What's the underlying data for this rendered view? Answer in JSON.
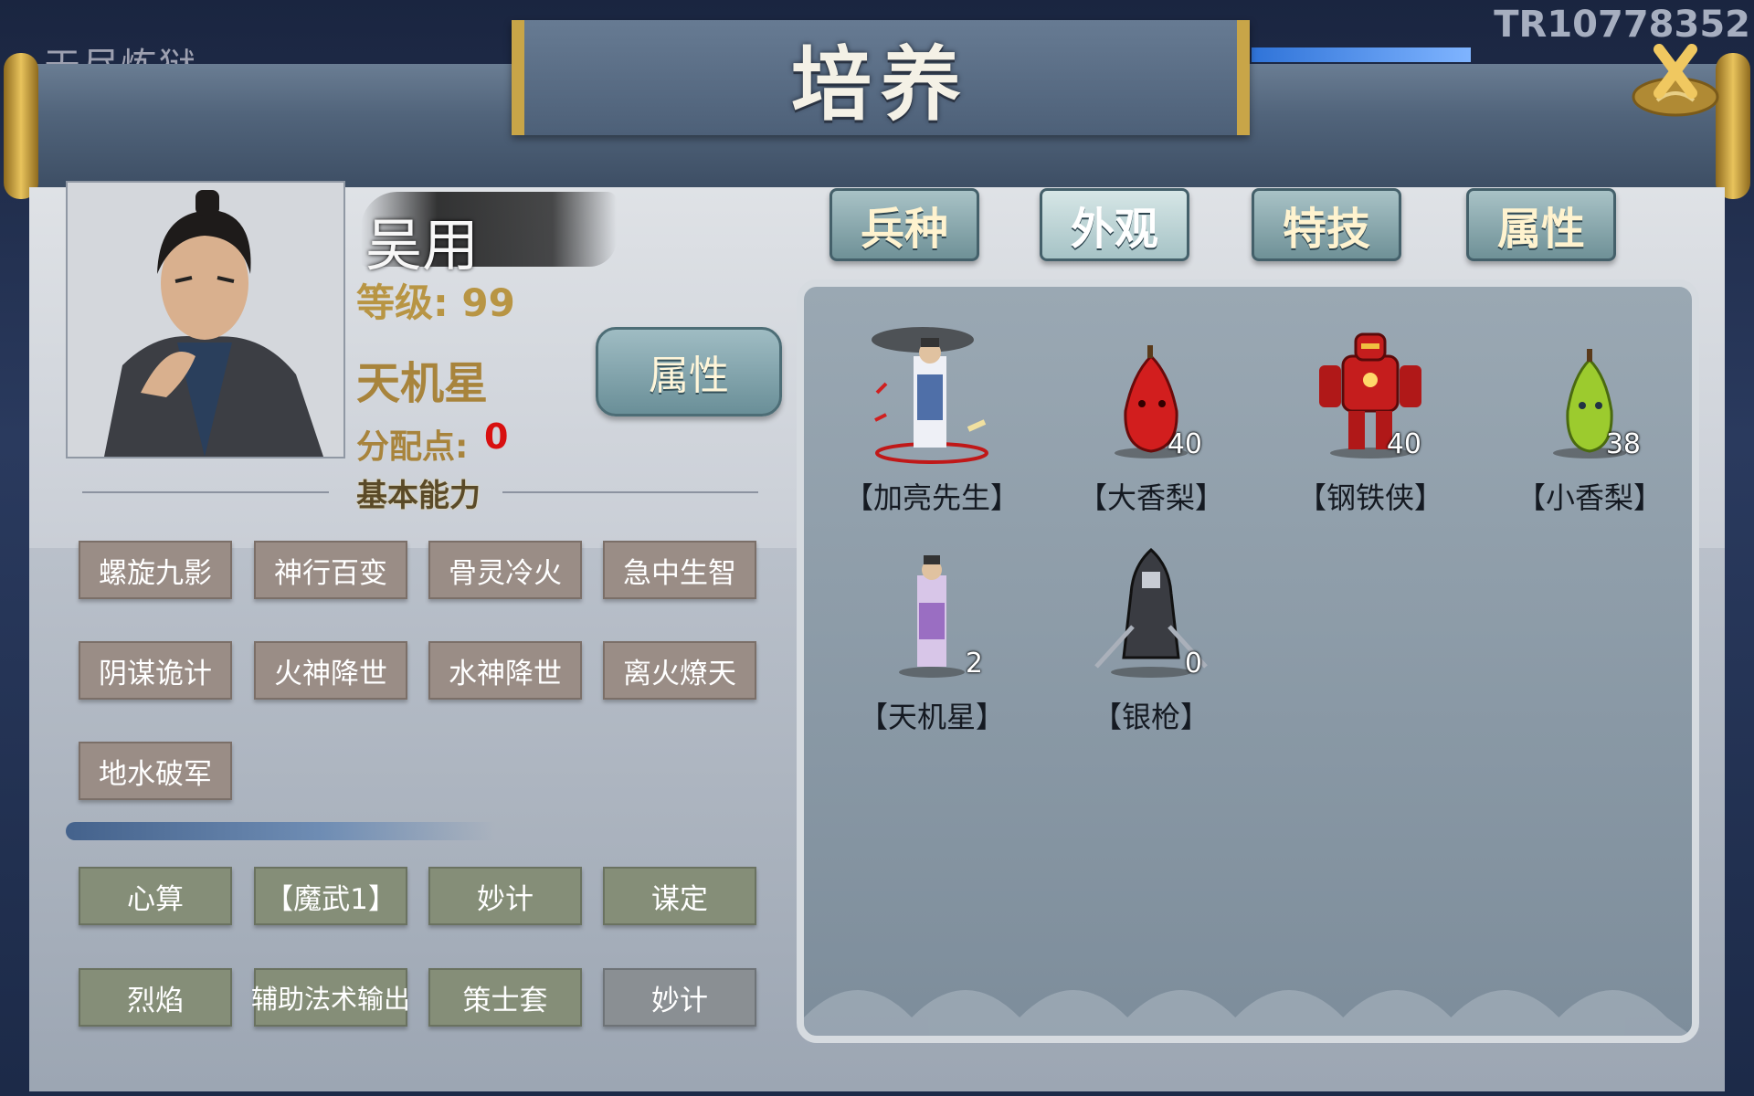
{
  "background": {
    "left_text": "天尽炼狱",
    "watermark": "TR10778352"
  },
  "title": "培养",
  "hero": {
    "name": "吴用",
    "level_label": "等级: 99",
    "star": "天机星",
    "points_label": "分配点:",
    "points_value": "0",
    "attribute_button": "属性"
  },
  "section_title": "基本能力",
  "skills_top": [
    "螺旋九影",
    "神行百变",
    "骨灵冷火",
    "急中生智",
    "阴谋诡计",
    "火神降世",
    "水神降世",
    "离火燎天",
    "地水破军"
  ],
  "skills_bottom": [
    "心算",
    "【魔武1】",
    "妙计",
    "谋定",
    "烈焰",
    "辅助法术输出",
    "策士套",
    "妙计"
  ],
  "tabs": [
    {
      "label": "兵种",
      "active": false
    },
    {
      "label": "外观",
      "active": true
    },
    {
      "label": "特技",
      "active": false
    },
    {
      "label": "属性",
      "active": false
    }
  ],
  "troops": [
    {
      "name": "【加亮先生】",
      "count": ""
    },
    {
      "name": "【大香梨】",
      "count": "40"
    },
    {
      "name": "【钢铁侠】",
      "count": "40"
    },
    {
      "name": "【小香梨】",
      "count": "38"
    },
    {
      "name": "【天机星】",
      "count": "2"
    },
    {
      "name": "【银枪】",
      "count": "0"
    }
  ],
  "colors": {
    "accent_gold": "#c8a548",
    "points_red": "#d81010"
  }
}
